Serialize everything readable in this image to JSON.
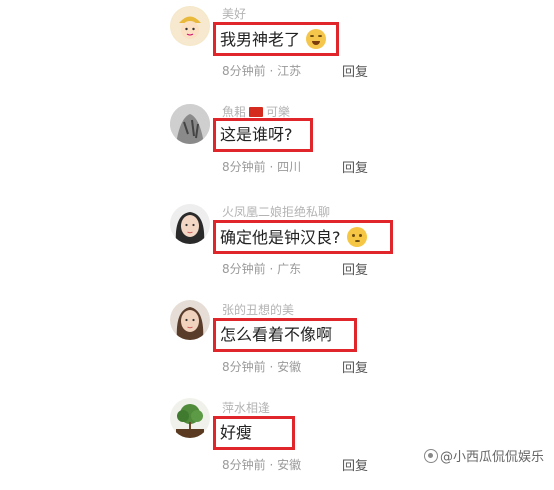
{
  "comments": [
    {
      "username": "美好",
      "text": "我男神老了",
      "time_location": "8分钟前 · 江苏",
      "reply": "回复",
      "emoji": "crying-laughing-emoji"
    },
    {
      "username": "魚耜",
      "username_suffix": "可樂",
      "text": "这是谁呀?",
      "time_location": "8分钟前 · 四川",
      "reply": "回复"
    },
    {
      "username": "火凤凰二娘拒绝私聊",
      "text": "确定他是钟汉良?",
      "time_location": "8分钟前 · 广东",
      "reply": "回复",
      "emoji": "thinking-emoji"
    },
    {
      "username": "张的丑想的美",
      "text": "怎么看着不像啊",
      "time_location": "8分钟前 · 安徽",
      "reply": "回复"
    },
    {
      "username": "萍水相逢",
      "text": "好瘦",
      "time_location": "8分钟前 · 安徽",
      "reply": "回复"
    }
  ],
  "watermark": "@小西瓜侃侃娱乐",
  "colors": {
    "highlight_border": "#e0252b",
    "meta_text": "#9a9a9a"
  }
}
